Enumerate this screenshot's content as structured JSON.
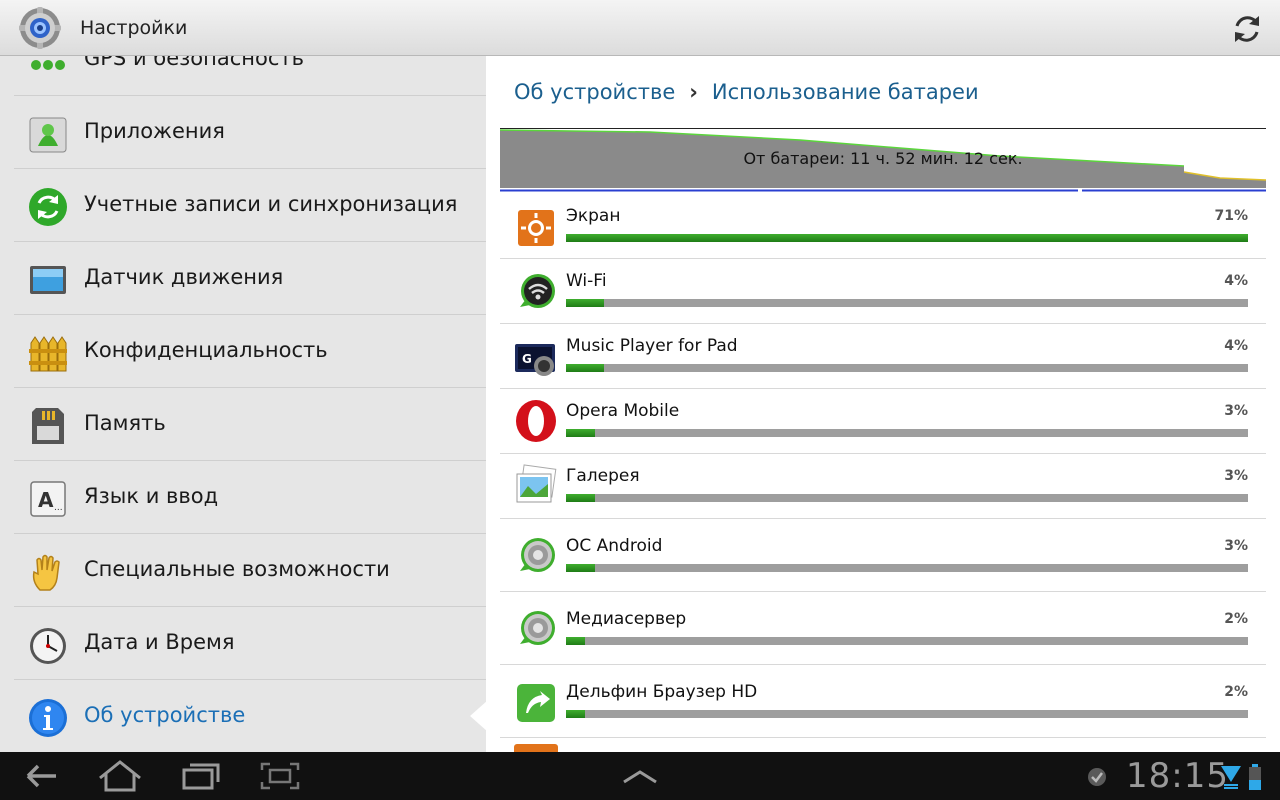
{
  "header": {
    "title": "Настройки",
    "app_icon": "settings-gear-icon",
    "refresh_icon": "refresh-icon"
  },
  "sidebar": {
    "items": [
      {
        "label": "GPS и безопасность",
        "icon": "location-security-icon"
      },
      {
        "label": "Приложения",
        "icon": "applications-icon"
      },
      {
        "label": "Учетные записи и синхронизация",
        "icon": "sync-icon"
      },
      {
        "label": "Датчик движения",
        "icon": "motion-sensor-icon"
      },
      {
        "label": "Конфиденциальность",
        "icon": "privacy-fence-icon"
      },
      {
        "label": "Память",
        "icon": "sd-card-icon"
      },
      {
        "label": "Язык и ввод",
        "icon": "keyboard-icon"
      },
      {
        "label": "Специальные возможности",
        "icon": "hand-icon"
      },
      {
        "label": "Дата и Время",
        "icon": "clock-icon"
      },
      {
        "label": "Об устройстве",
        "icon": "info-icon",
        "active": true
      }
    ]
  },
  "main": {
    "breadcrumb": {
      "parent": "Об устройстве",
      "separator": "›",
      "current": "Использование батареи"
    },
    "battery_graph": {
      "label": "От батареи: 11 ч. 52 мин. 12 сек."
    },
    "usage": [
      {
        "name": "Экран",
        "percent_label": "71%",
        "percent": 71,
        "icon": "screen-brightness-icon"
      },
      {
        "name": "Wi-Fi",
        "percent_label": "4%",
        "percent": 4,
        "icon": "wifi-icon"
      },
      {
        "name": "Music Player for Pad",
        "percent_label": "4%",
        "percent": 4,
        "icon": "music-player-icon"
      },
      {
        "name": "Opera Mobile",
        "percent_label": "3%",
        "percent": 3,
        "icon": "opera-icon"
      },
      {
        "name": "Галерея",
        "percent_label": "3%",
        "percent": 3,
        "icon": "gallery-icon"
      },
      {
        "name": "ОС Android",
        "percent_label": "3%",
        "percent": 3,
        "icon": "android-os-icon"
      },
      {
        "name": "Медиасервер",
        "percent_label": "2%",
        "percent": 2,
        "icon": "media-server-icon"
      },
      {
        "name": "Дельфин Браузер HD",
        "percent_label": "2%",
        "percent": 2,
        "icon": "dolphin-browser-icon"
      }
    ]
  },
  "system_bar": {
    "clock": "18:15"
  },
  "colors": {
    "accent": "#1b6fb6",
    "bar_fill": "#2e8f22",
    "bar_track": "#9e9e9e",
    "graph_fill": "#8a8a8a",
    "graph_line": "#5bd63c"
  }
}
